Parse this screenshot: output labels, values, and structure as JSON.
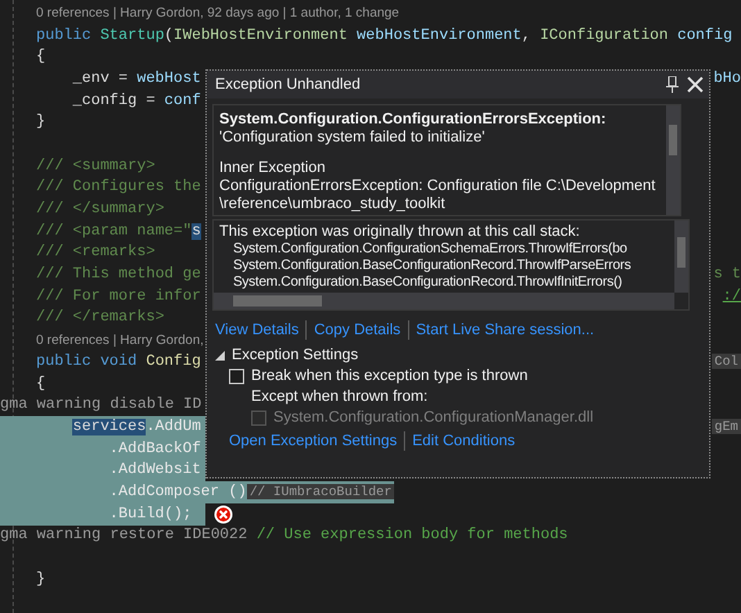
{
  "editor": {
    "lines": [
      {
        "kind": "lens",
        "segments": [
          {
            "text": "0 references | Harry Gordon, 92 days ago | 1 author, 1 change",
            "kind": "lens"
          }
        ]
      },
      {
        "kind": "code",
        "segments": [
          {
            "text": "public",
            "kind": "kw"
          },
          {
            "text": " Startup",
            "kind": "type"
          },
          {
            "text": "(",
            "kind": "plain"
          },
          {
            "text": "IWebHostEnvironment",
            "kind": "iface"
          },
          {
            "text": " webHostEnvironment",
            "kind": "param"
          },
          {
            "text": ", ",
            "kind": "plain"
          },
          {
            "text": "IConfiguration",
            "kind": "iface"
          },
          {
            "text": " config",
            "kind": "param"
          }
        ]
      },
      {
        "kind": "code",
        "segments": [
          {
            "text": "{",
            "kind": "plain"
          }
        ],
        "children": [
          {
            "kind": "code",
            "segments": [
              {
                "text": "_env = ",
                "kind": "plain"
              },
              {
                "text": "webHost",
                "kind": "param"
              }
            ],
            "right": {
              "text": "bHo",
              "kind": "param"
            }
          },
          {
            "kind": "code",
            "segments": [
              {
                "text": "_config = ",
                "kind": "plain"
              },
              {
                "text": "conf",
                "kind": "param"
              }
            ]
          }
        ]
      },
      {
        "kind": "code",
        "segments": [
          {
            "text": "}",
            "kind": "plain"
          }
        ]
      },
      {
        "kind": "blank"
      },
      {
        "kind": "code",
        "segments": [
          {
            "text": "/// <summary>",
            "kind": "doc"
          }
        ]
      },
      {
        "kind": "code",
        "segments": [
          {
            "text": "/// Configures the",
            "kind": "doc"
          }
        ]
      },
      {
        "kind": "code",
        "segments": [
          {
            "text": "/// </summary>",
            "kind": "doc"
          }
        ]
      },
      {
        "kind": "code",
        "segments": [
          {
            "text": "/// <param name=\"",
            "kind": "doc"
          },
          {
            "text": "s",
            "kind": "selected"
          }
        ]
      },
      {
        "kind": "code",
        "segments": [
          {
            "text": "/// <remarks>",
            "kind": "doc"
          }
        ]
      },
      {
        "kind": "code",
        "segments": [
          {
            "text": "/// This method ge",
            "kind": "doc"
          }
        ],
        "right": {
          "text": "s t",
          "kind": "doc"
        }
      },
      {
        "kind": "code",
        "segments": [
          {
            "text": "/// For more infor",
            "kind": "doc"
          }
        ],
        "right": {
          "text": ":/",
          "kind": "link"
        }
      },
      {
        "kind": "code",
        "segments": [
          {
            "text": "/// </remarks>",
            "kind": "doc"
          }
        ]
      },
      {
        "kind": "lens",
        "segments": [
          {
            "text": "0 references | Harry Gordon,",
            "kind": "lens"
          }
        ]
      },
      {
        "kind": "code",
        "segments": [
          {
            "text": "public void",
            "kind": "kw"
          },
          {
            "text": " Config",
            "kind": "method"
          }
        ],
        "right": {
          "text": "Col",
          "kind": "hint"
        }
      },
      {
        "kind": "code",
        "segments": [
          {
            "text": "{",
            "kind": "plain"
          }
        ],
        "children": [
          {
            "kind": "pragma",
            "segments": [
              {
                "text": "gma warning disable ID",
                "kind": "pragma"
              }
            ]
          },
          {
            "kind": "code",
            "highlighted": true,
            "segments": [
              {
                "text": "services",
                "kind": "selected"
              },
              {
                "text": ".AddUm",
                "kind": "plain"
              }
            ],
            "right": {
              "text": "gEm",
              "kind": "hint"
            },
            "children": [
              {
                "kind": "code",
                "highlighted": true,
                "segments": [
                  {
                    "text": ".AddBackOf",
                    "kind": "plain"
                  }
                ]
              },
              {
                "kind": "code",
                "highlighted": true,
                "segments": [
                  {
                    "text": ".AddWebsit",
                    "kind": "plain"
                  }
                ]
              },
              {
                "kind": "code",
                "highlighted": true,
                "segments": [
                  {
                    "text": ".AddComposer",
                    "kind": "plain"
                  },
                  {
                    "text": " ()",
                    "kind": "plain"
                  },
                  {
                    "text": "// IUmbracoBuilder",
                    "kind": "hint"
                  }
                ]
              },
              {
                "kind": "code",
                "highlighted": true,
                "error": true,
                "segments": [
                  {
                    "text": ".Build();",
                    "kind": "plain"
                  }
                ]
              }
            ]
          },
          {
            "kind": "pragma",
            "segments": [
              {
                "text": "gma warning restore IDE0022",
                "kind": "pragma"
              },
              {
                "text": " // Use expression body for methods",
                "kind": "comment"
              }
            ]
          }
        ]
      },
      {
        "kind": "blank"
      },
      {
        "kind": "code",
        "segments": [
          {
            "text": "}",
            "kind": "plain"
          }
        ]
      }
    ]
  },
  "exception_popup": {
    "title": "Exception Unhandled",
    "exception_type": "System.Configuration.ConfigurationErrorsException:",
    "message": "'Configuration system failed to initialize'",
    "inner_heading": "Inner Exception",
    "inner_lines": [
      "ConfigurationErrorsException: Configuration file C:\\Development",
      "\\reference\\umbraco_study_toolkit"
    ],
    "stack_heading": "This exception was originally thrown at this call stack:",
    "stack_frames": [
      "System.Configuration.ConfigurationSchemaErrors.ThrowIfErrors(bo",
      "System.Configuration.BaseConfigurationRecord.ThrowIfParseErrors",
      "System.Configuration.BaseConfigurationRecord.ThrowIfInitErrors()"
    ],
    "links": [
      "View Details",
      "Copy Details",
      "Start Live Share session..."
    ],
    "settings": {
      "title": "Exception Settings",
      "expanded": true,
      "break_checkbox": {
        "label": "Break when this exception type is thrown",
        "checked": false,
        "disabled": false
      },
      "except_label": "Except when thrown from:",
      "module_checkbox": {
        "label": "System.Configuration.ConfigurationManager.dll",
        "checked": false,
        "disabled": true
      }
    },
    "footer_links": [
      "Open Exception Settings",
      "Edit Conditions"
    ]
  }
}
